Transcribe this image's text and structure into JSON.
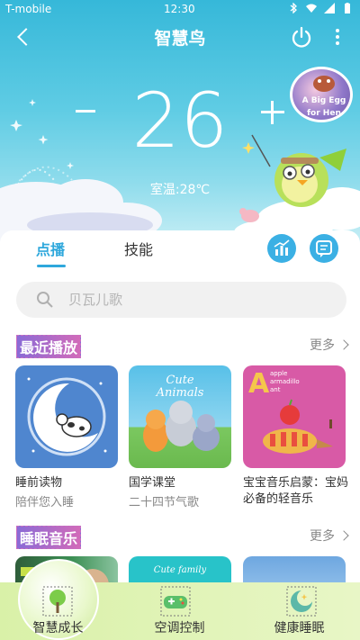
{
  "status_bar": {
    "carrier": "T-mobile",
    "time": "12:30"
  },
  "header": {
    "title": "智慧鸟"
  },
  "thermostat": {
    "temperature": "26",
    "room_temperature": "室温:28℃"
  },
  "story_badge": {
    "line1": "A Big Egg",
    "line2": "for Hen"
  },
  "tabs": [
    {
      "label": "点播"
    },
    {
      "label": "技能"
    }
  ],
  "search": {
    "placeholder": "贝瓦儿歌"
  },
  "recent": {
    "title": "最近播放",
    "more": "更多",
    "items": [
      {
        "title": "睡前读物",
        "subtitle": "陪伴您入睡"
      },
      {
        "title": "国学课堂",
        "subtitle": "二十四节气歌"
      },
      {
        "title": "宝宝音乐启蒙：宝妈必备的轻音乐",
        "subtitle": ""
      }
    ],
    "tile_texts": {
      "cute_animals_1": "Cute",
      "cute_animals_2": "Animals",
      "apple": "apple",
      "armadillo": "armadillo",
      "ant": "ant",
      "big_a": "A"
    }
  },
  "sleep": {
    "title": "睡眠音乐",
    "more": "更多",
    "tile_texts": {
      "cute_family": "Cute family"
    }
  },
  "bottom_nav": [
    {
      "label": "智慧成长"
    },
    {
      "label": "空调控制"
    },
    {
      "label": "健康睡眠"
    }
  ],
  "colors": {
    "accent": "#2fa8dc",
    "nav_bg": "#dff3b5",
    "sky": "#36b8d9"
  }
}
